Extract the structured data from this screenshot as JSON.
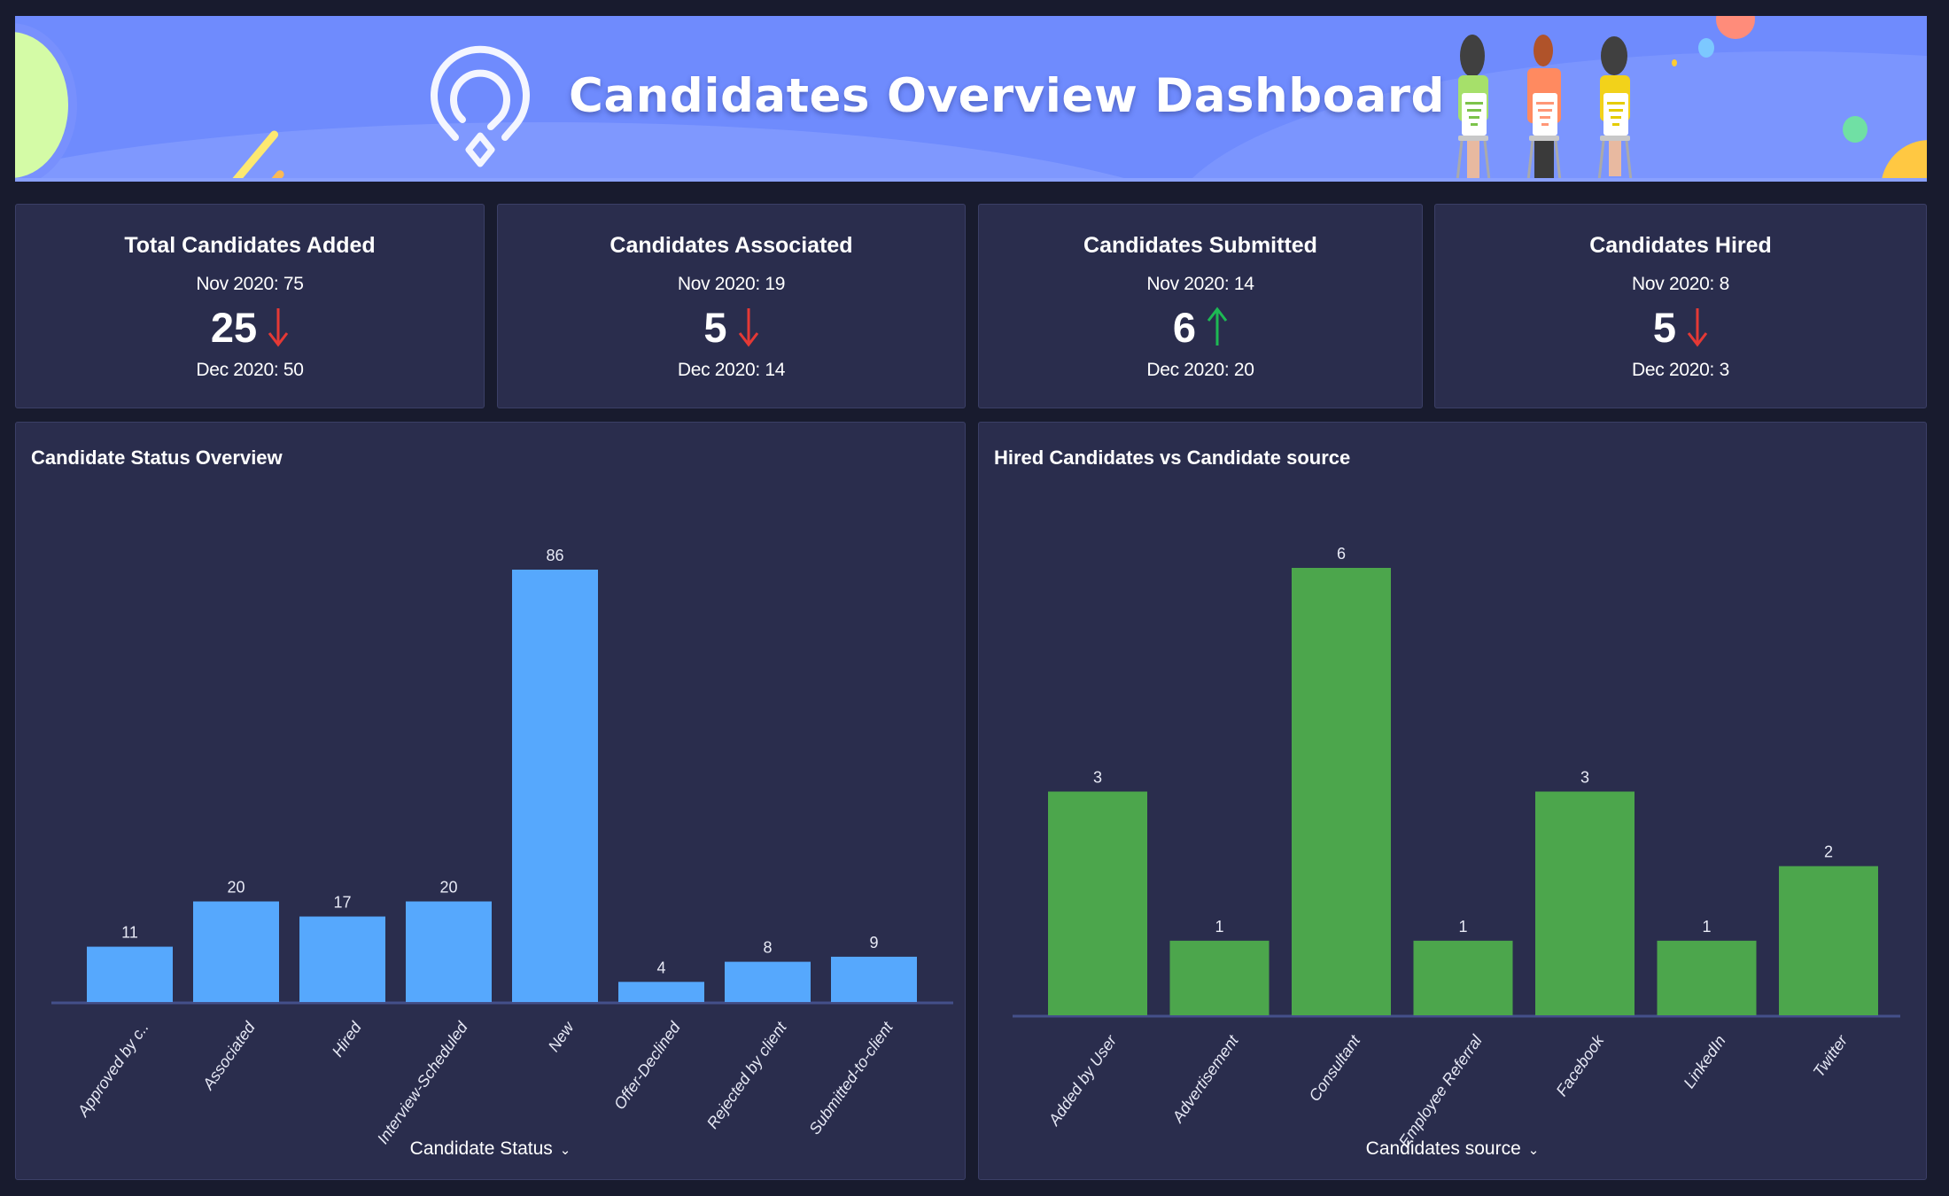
{
  "header": {
    "title": "Candidates Overview Dashboard",
    "banner_color": "#6f8bfd",
    "logo_icon": "location-pin-logo-icon",
    "illustration": "three-people-seated-icon"
  },
  "kpis": [
    {
      "title": "Total Candidates Added",
      "prev_label": "Nov 2020: 75",
      "value": "25",
      "trend": "down",
      "curr_label": "Dec 2020: 50"
    },
    {
      "title": "Candidates Associated",
      "prev_label": "Nov 2020: 19",
      "value": "5",
      "trend": "down",
      "curr_label": "Dec 2020: 14"
    },
    {
      "title": "Candidates Submitted",
      "prev_label": "Nov 2020: 14",
      "value": "6",
      "trend": "up",
      "curr_label": "Dec 2020: 20"
    },
    {
      "title": "Candidates Hired",
      "prev_label": "Nov 2020: 8",
      "value": "5",
      "trend": "down",
      "curr_label": "Dec 2020: 3"
    }
  ],
  "colors": {
    "down": "#e53935",
    "up": "#1db954",
    "bar_blue": "#56a8fd",
    "bar_green": "#4ca64c",
    "panel_bg": "#2a2d4d",
    "page_bg": "#181b2e"
  },
  "panels": {
    "left": {
      "title": "Candidate Status Overview",
      "axis_label": "Candidate Status",
      "chevron": "chevron-down-icon"
    },
    "right": {
      "title": "Hired Candidates vs Candidate source",
      "axis_label": "Candidates source",
      "chevron": "chevron-down-icon"
    }
  },
  "chart_data": [
    {
      "type": "bar",
      "title": "Candidate Status Overview",
      "xlabel": "Candidate Status",
      "ylabel": "",
      "categories": [
        "Approved by c..",
        "Associated",
        "Hired",
        "Interview-Scheduled",
        "New",
        "Offer-Declined",
        "Rejected by client",
        "Submitted-to-client"
      ],
      "values": [
        11,
        20,
        17,
        20,
        86,
        4,
        8,
        9
      ],
      "ylim": [
        0,
        86
      ],
      "grid": false,
      "legend": "none",
      "data_labels": true
    },
    {
      "type": "bar",
      "title": "Hired Candidates vs Candidate source",
      "xlabel": "Candidates source",
      "ylabel": "",
      "categories": [
        "Added by User",
        "Advertisement",
        "Consultant",
        "Employee Referral",
        "Facebook",
        "LinkedIn",
        "Twitter"
      ],
      "values": [
        3,
        1,
        6,
        1,
        3,
        1,
        2
      ],
      "ylim": [
        0,
        6
      ],
      "grid": false,
      "legend": "none",
      "data_labels": true
    }
  ]
}
